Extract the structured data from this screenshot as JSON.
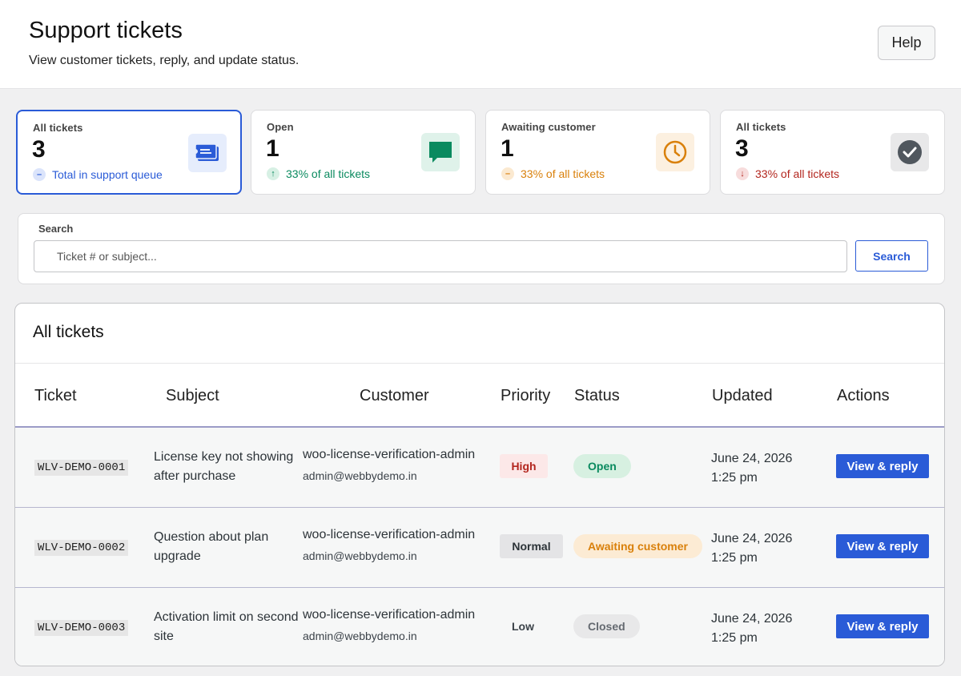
{
  "header": {
    "title": "Support tickets",
    "subtitle": "View customer tickets, reply, and update status.",
    "help_label": "Help"
  },
  "cards": [
    {
      "label": "All tickets",
      "count": "3",
      "trend": "Total in support queue",
      "trend_symbol": "–",
      "icon": "ticket-icon",
      "color": "#2a5bd7"
    },
    {
      "label": "Open",
      "count": "1",
      "trend": "33% of all tickets",
      "trend_symbol": "↑",
      "icon": "chat-bubble-icon",
      "color": "#0a8a5f"
    },
    {
      "label": "Awaiting customer",
      "count": "1",
      "trend": "33% of all tickets",
      "trend_symbol": "–",
      "icon": "clock-icon",
      "color": "#d9800b"
    },
    {
      "label": "All tickets",
      "count": "3",
      "trend": "33% of all tickets",
      "trend_symbol": "↓",
      "icon": "check-circle-icon",
      "color": "#b3261e"
    }
  ],
  "search": {
    "label": "Search",
    "placeholder": "Ticket # or subject...",
    "button_label": "Search"
  },
  "table": {
    "title": "All tickets",
    "columns": [
      "Ticket",
      "Subject",
      "Customer",
      "Priority",
      "Status",
      "Updated",
      "Actions"
    ],
    "rows": [
      {
        "ticket": "WLV-DEMO-0001",
        "subject": "License key not showing after purchase",
        "customer": "woo-license-verification-admin",
        "email": "admin@webbydemo.in",
        "priority": "High",
        "status": "Open",
        "updated_date": "June 24, 2026",
        "updated_time": "1:25 pm",
        "action": "View & reply"
      },
      {
        "ticket": "WLV-DEMO-0002",
        "subject": "Question about plan upgrade",
        "customer": "woo-license-verification-admin",
        "email": "admin@webbydemo.in",
        "priority": "Normal",
        "status": "Awaiting customer",
        "updated_date": "June 24, 2026",
        "updated_time": "1:25 pm",
        "action": "View & reply"
      },
      {
        "ticket": "WLV-DEMO-0003",
        "subject": "Activation limit on second site",
        "customer": "woo-license-verification-admin",
        "email": "admin@webbydemo.in",
        "priority": "Low",
        "status": "Closed",
        "updated_date": "June 24, 2026",
        "updated_time": "1:25 pm",
        "action": "View & reply"
      }
    ]
  },
  "colors": {
    "accent": "#2a5bd7",
    "open": "#0a8a5f",
    "awaiting": "#d9800b",
    "high": "#b3261e",
    "closed": "#646970"
  }
}
